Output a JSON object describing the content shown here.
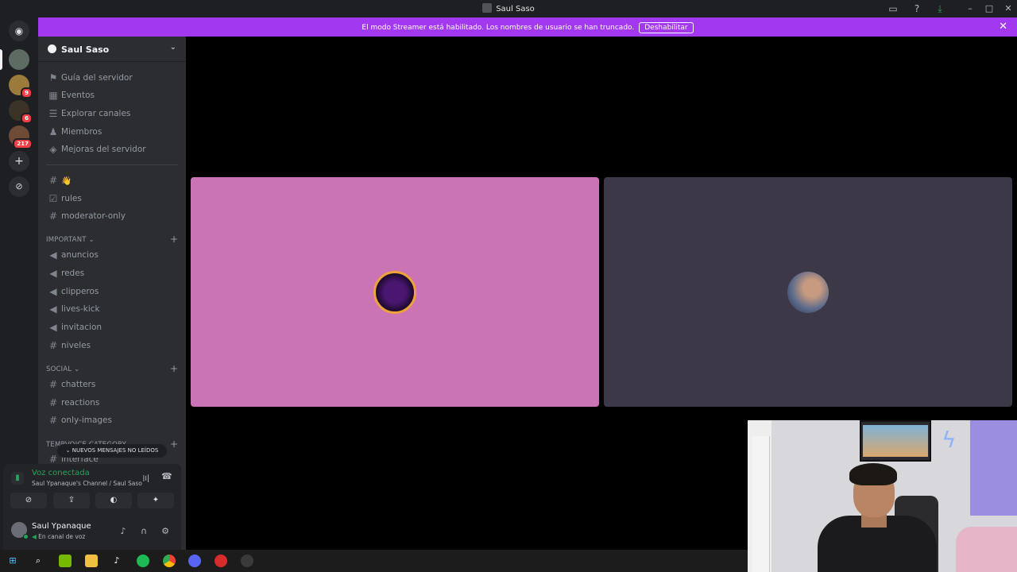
{
  "window": {
    "title": "Saul Saso"
  },
  "banner": {
    "message": "El modo Streamer está habilitado. Los nombres de usuario se han truncado.",
    "button_label": "Deshabilitar"
  },
  "rail": {
    "badges": [
      "9",
      "6",
      "217"
    ]
  },
  "server": {
    "name": "Saul Saso"
  },
  "nav_items": [
    {
      "label": "Guía del servidor",
      "icon": "signpost-icon"
    },
    {
      "label": "Eventos",
      "icon": "calendar-icon"
    },
    {
      "label": "Explorar canales",
      "icon": "list-icon"
    },
    {
      "label": "Miembros",
      "icon": "members-icon"
    },
    {
      "label": "Mejoras del servidor",
      "icon": "boost-icon"
    }
  ],
  "channels_top": [
    {
      "label": "👋",
      "icon": "hash-icon"
    },
    {
      "label": "rules",
      "icon": "rules-icon"
    },
    {
      "label": "moderator-only",
      "icon": "hash-icon"
    }
  ],
  "category_important": {
    "label": "IMPORTANT",
    "channels": [
      {
        "label": "anuncios",
        "icon": "megaphone-icon"
      },
      {
        "label": "redes",
        "icon": "megaphone-icon"
      },
      {
        "label": "clipperos",
        "icon": "megaphone-icon"
      },
      {
        "label": "lives-kick",
        "icon": "megaphone-icon"
      },
      {
        "label": "invitacion",
        "icon": "megaphone-icon"
      },
      {
        "label": "niveles",
        "icon": "hash-icon"
      }
    ]
  },
  "category_social": {
    "label": "SOCIAL",
    "channels": [
      {
        "label": "chatters",
        "icon": "hash-icon"
      },
      {
        "label": "reactions",
        "icon": "hash-icon"
      },
      {
        "label": "only-images",
        "icon": "hash-icon"
      }
    ]
  },
  "category_tempvoice": {
    "label": "TEMPVOICE CATEGORY",
    "channels": [
      {
        "label": "interface",
        "icon": "hash-icon"
      }
    ]
  },
  "unread_pill": "NUEVOS MENSAJES NO LEÍDOS",
  "voice": {
    "status": "Voz conectada",
    "channel": "Saul Ypanaque's Channel / Saul Saso"
  },
  "user": {
    "name": "Saul Ypanaque",
    "status": "En canal de voz"
  },
  "colors": {
    "banner": "#a239f0",
    "tile_a": "#cb74b5",
    "tile_b": "#3d3848",
    "online": "#23a55a"
  }
}
